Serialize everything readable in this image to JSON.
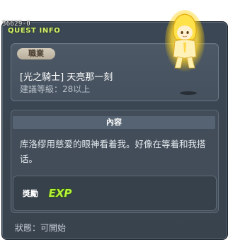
{
  "quest": {
    "id": "36629-0",
    "window_title": "QUEST INFO"
  },
  "job": {
    "tag": "職業",
    "name": "[光之騎士] 天亮那一刻",
    "level_text": "建議等級：28以上"
  },
  "content": {
    "header": "內容",
    "text": "库洛缪用慈爱的眼神看着我。好像在等着和我搭话。"
  },
  "reward": {
    "label": "獎勵",
    "icon": "exp-icon",
    "icon_text": "EXP"
  },
  "status": {
    "text": "狀態：可開始"
  },
  "colors": {
    "window_bg": "#3b4754",
    "title_color": "#d8f06a",
    "exp_green": "#b7f23a"
  }
}
